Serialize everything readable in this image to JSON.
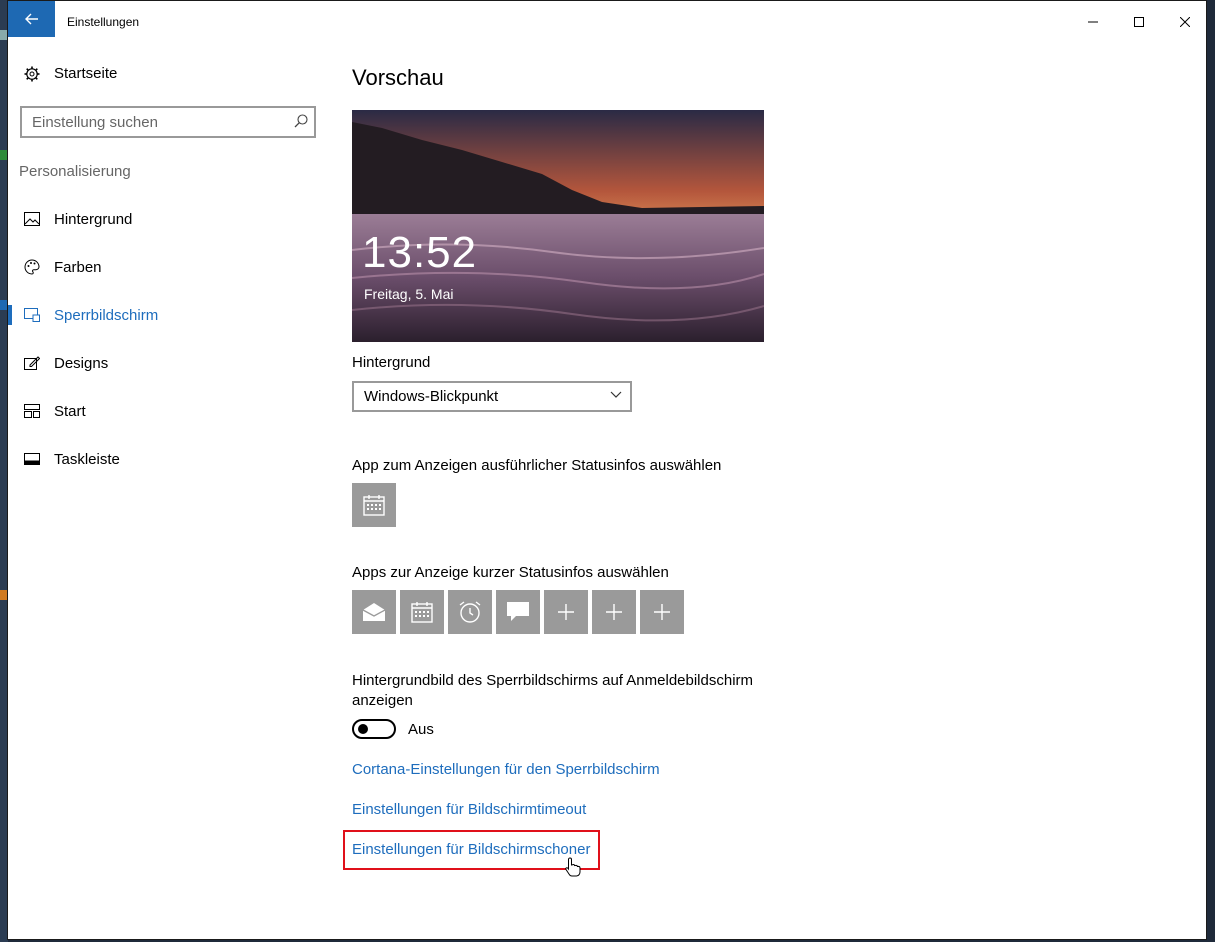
{
  "window": {
    "title": "Einstellungen"
  },
  "sidebar": {
    "home_label": "Startseite",
    "search_placeholder": "Einstellung suchen",
    "section_label": "Personalisierung",
    "items": [
      {
        "label": "Hintergrund",
        "icon": "image-icon",
        "active": false
      },
      {
        "label": "Farben",
        "icon": "palette-icon",
        "active": false
      },
      {
        "label": "Sperrbildschirm",
        "icon": "lock-screen-icon",
        "active": true
      },
      {
        "label": "Designs",
        "icon": "designs-icon",
        "active": false
      },
      {
        "label": "Start",
        "icon": "start-icon",
        "active": false
      },
      {
        "label": "Taskleiste",
        "icon": "taskbar-icon",
        "active": false
      }
    ]
  },
  "main": {
    "heading": "Vorschau",
    "preview": {
      "time": "13:52",
      "date": "Freitag, 5. Mai"
    },
    "background_label": "Hintergrund",
    "background_value": "Windows-Blickpunkt",
    "detailed_status_label": "App zum Anzeigen ausführlicher Statusinfos auswählen",
    "detailed_status_icon": "calendar-icon",
    "quick_status_label": "Apps zur Anzeige kurzer Statusinfos auswählen",
    "quick_status_icons": [
      "mail-icon",
      "calendar-icon",
      "alarm-icon",
      "message-icon",
      "plus-icon",
      "plus-icon",
      "plus-icon"
    ],
    "signin_label": "Hintergrundbild des Sperrbildschirms auf Anmeldebildschirm anzeigen",
    "toggle_state": "Aus",
    "links": [
      "Cortana-Einstellungen für den Sperrbildschirm",
      "Einstellungen für Bildschirmtimeout",
      "Einstellungen für Bildschirmschoner"
    ]
  },
  "colors": {
    "accent": "#1e6dbd",
    "title_back_button": "#1e69b3",
    "highlight_box": "#e0101a",
    "tile": "#9a9a9a"
  }
}
